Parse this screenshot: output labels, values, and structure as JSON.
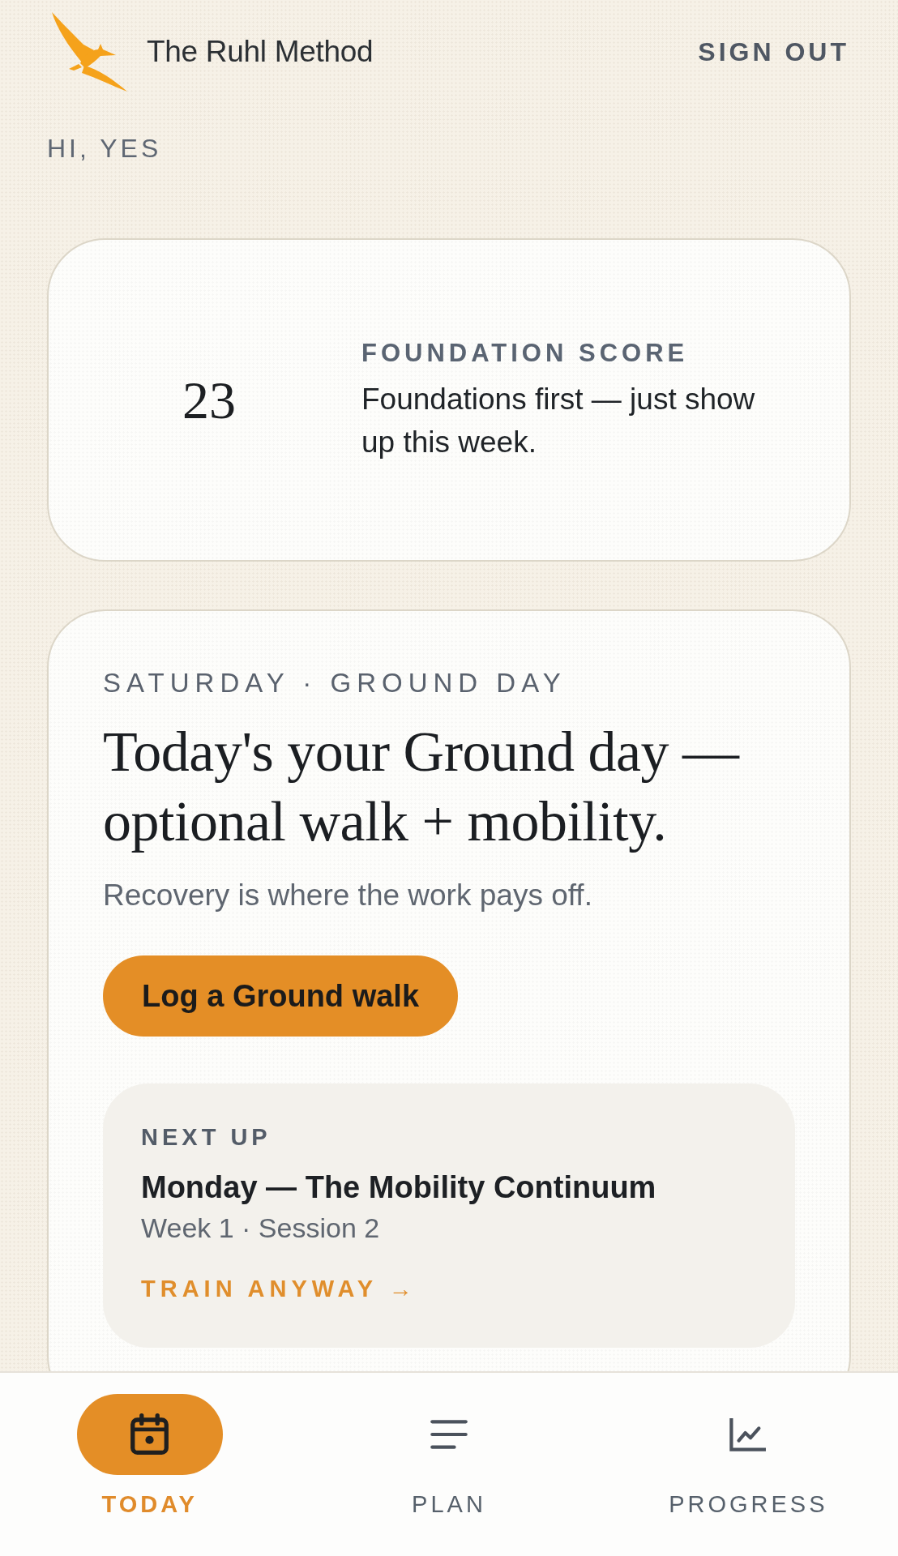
{
  "header": {
    "brand": "The Ruhl Method",
    "sign_out": "SIGN OUT"
  },
  "greeting": "HI, YES",
  "score_card": {
    "score": "23",
    "label": "FOUNDATION SCORE",
    "message": "Foundations first — just show up this week."
  },
  "today_card": {
    "kicker": "SATURDAY · GROUND DAY",
    "headline": "Today's your Ground day — optional walk + mobility.",
    "subtitle": "Recovery is where the work pays off.",
    "action": "Log a Ground walk",
    "next_up": {
      "label": "NEXT UP",
      "title": "Monday — The Mobility Continuum",
      "detail": "Week 1 · Session 2",
      "link": "TRAIN ANYWAY →"
    }
  },
  "nav": {
    "tabs": [
      {
        "label": "TODAY",
        "selected": true
      },
      {
        "label": "PLAN",
        "selected": false
      },
      {
        "label": "PROGRESS",
        "selected": false
      }
    ]
  }
}
